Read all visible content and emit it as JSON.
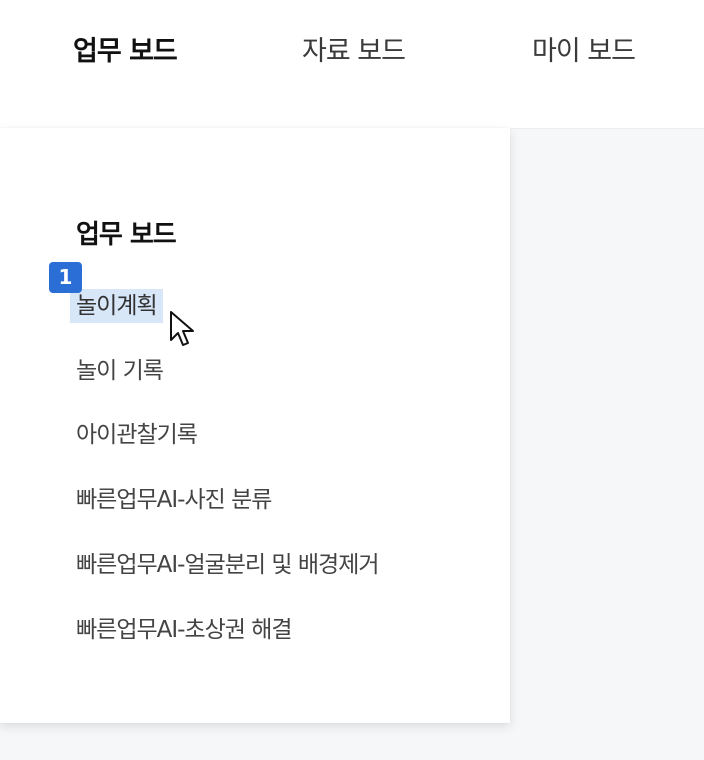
{
  "topnav": {
    "tabs": [
      {
        "label": "업무 보드",
        "active": true
      },
      {
        "label": "자료 보드",
        "active": false
      },
      {
        "label": "마이 보드",
        "active": false
      }
    ]
  },
  "dropdown": {
    "title": "업무 보드",
    "items": [
      {
        "label": "놀이계획",
        "highlighted": true
      },
      {
        "label": "놀이 기록"
      },
      {
        "label": "아이관찰기록"
      },
      {
        "label": "빠른업무AI-사진 분류"
      },
      {
        "label": "빠른업무AI-얼굴분리 및 배경제거"
      },
      {
        "label": "빠른업무AI-초상권 해결"
      }
    ]
  },
  "annotation": {
    "badge_number": "1"
  },
  "colors": {
    "highlight": "#d7e7f8",
    "badge": "#2b6fd6",
    "content_bg": "#f5f7f9"
  },
  "icons": {
    "cursor": "mouse-pointer-icon"
  }
}
